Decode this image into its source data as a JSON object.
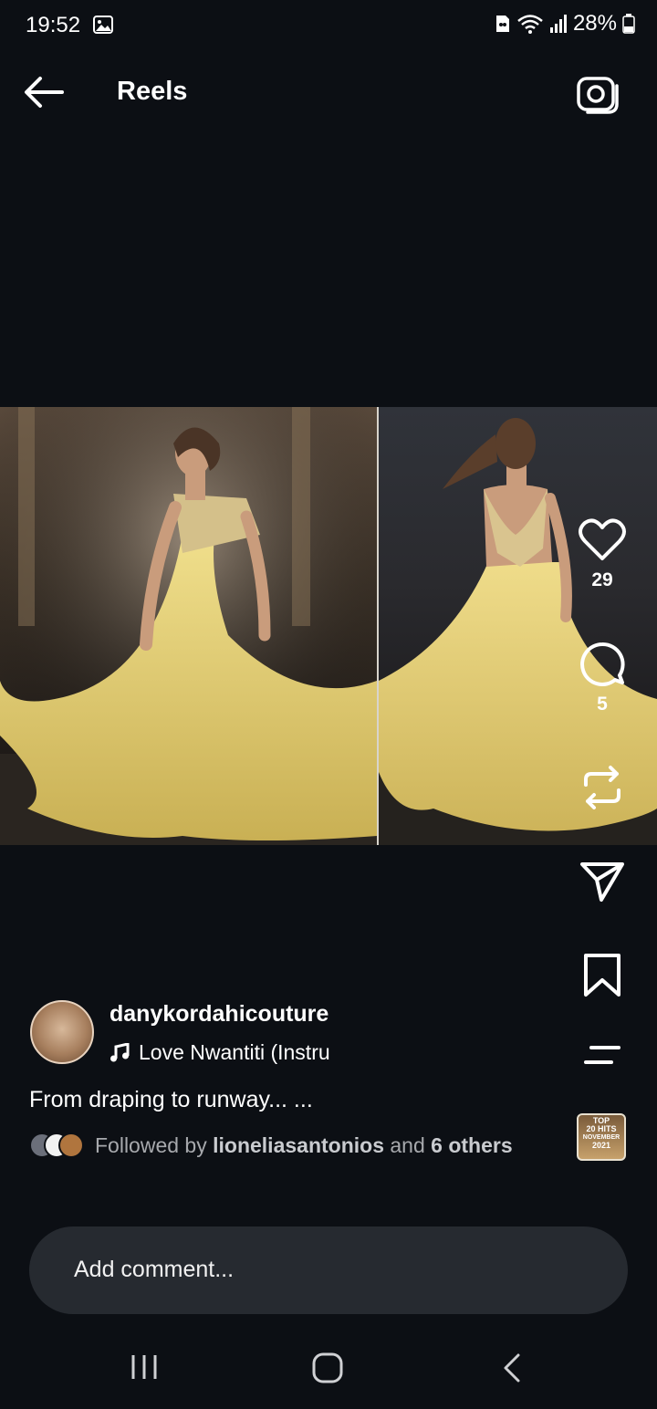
{
  "status_bar": {
    "time": "19:52",
    "battery": "28%",
    "icons": [
      "gallery-icon",
      "sim-icon",
      "wifi-icon",
      "signal-icon",
      "battery-icon"
    ]
  },
  "header": {
    "back_icon": "back-arrow-icon",
    "title": "Reels",
    "camera_icon": "camera-icon"
  },
  "media": {
    "panels": [
      "front-view",
      "back-view"
    ]
  },
  "actions": {
    "like_count": "29",
    "comment_count": "5",
    "icons": [
      "heart-icon",
      "comment-icon",
      "repost-icon",
      "send-icon",
      "bookmark-icon",
      "more-icon"
    ]
  },
  "post": {
    "username": "danykordahicouture",
    "music": "Love Nwantiti (Instru",
    "caption": "From draping to runway... ...",
    "followed_prefix": "Followed by ",
    "followed_user": "lioneliasantonios",
    "followed_mid": " and ",
    "followed_others": "6 others",
    "audio_thumb_text": [
      "TOP",
      "20 HITS",
      "NOVEMBER",
      "2021"
    ]
  },
  "comment": {
    "placeholder": "Add comment..."
  },
  "colors": {
    "background": "#0c0f14",
    "comment_box": "#262a30",
    "secondary_text": "#a7a9ad",
    "dress_yellow": "#e9d67a"
  }
}
